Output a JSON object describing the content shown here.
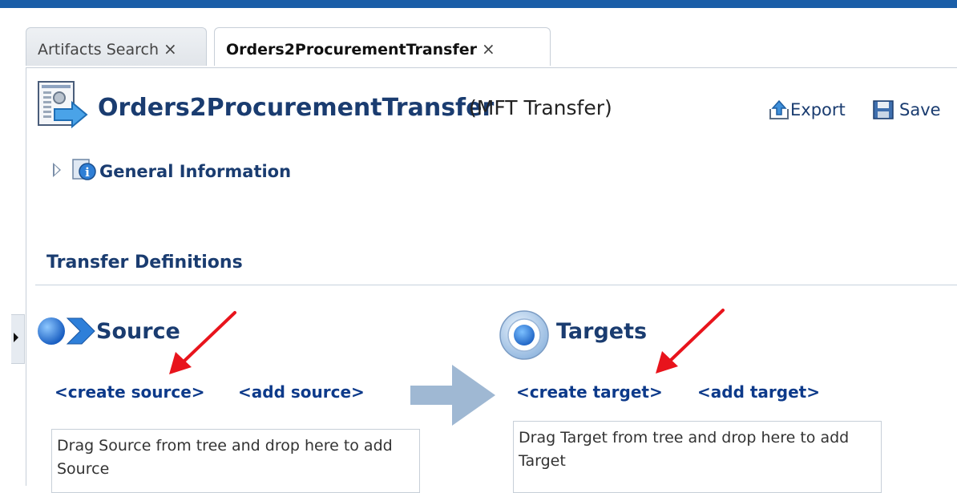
{
  "tabs": [
    {
      "label": "Artifacts Search",
      "close": "×"
    },
    {
      "label": "Orders2ProcurementTransfer",
      "close": "×"
    }
  ],
  "page": {
    "title": "Orders2ProcurementTransfer",
    "subtitle": "(MFT Transfer)"
  },
  "toolbar": {
    "export_label": "Export",
    "save_label": "Save"
  },
  "general_info": {
    "label": "General Information"
  },
  "transfer_definitions": {
    "heading": "Transfer Definitions",
    "source": {
      "title": "Source",
      "create_link": "<create source>",
      "add_link": "<add source>",
      "drop_text": "Drag Source from tree and drop here to add Source"
    },
    "targets": {
      "title": "Targets",
      "create_link": "<create target>",
      "add_link": "<add target>",
      "drop_text": "Drag Target from tree and drop here to add Target"
    }
  },
  "colors": {
    "brand_bar": "#1a5ea8",
    "heading": "#1a3c70",
    "link": "#0d3a8a",
    "annotation_arrow": "#e8141c"
  },
  "icons": {
    "document": "transfer-document-icon",
    "export": "export-icon",
    "save": "save-icon",
    "info": "info-icon",
    "source": "source-icon",
    "target": "target-icon"
  }
}
